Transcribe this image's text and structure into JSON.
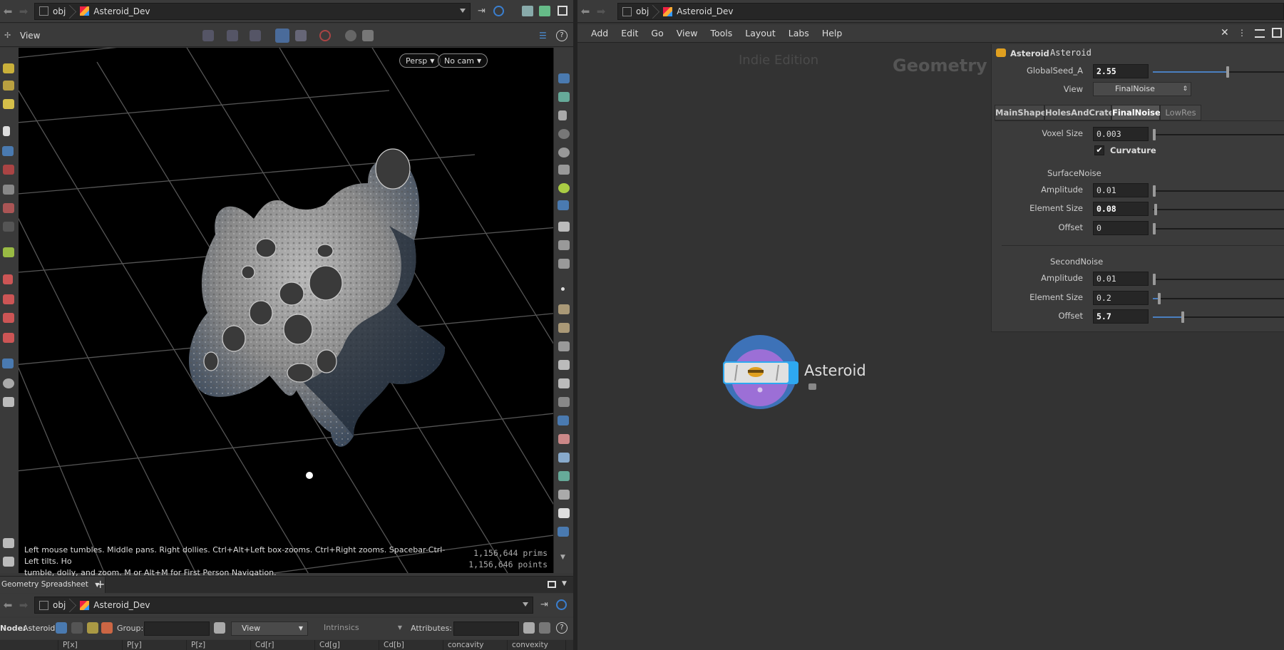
{
  "left_pane": {
    "path": {
      "root": "obj",
      "node": "Asteroid_Dev"
    },
    "viewbar": {
      "title": "View"
    },
    "viewport": {
      "camera_mode": "Persp",
      "camera": "No cam",
      "hint_line1": "Left mouse tumbles. Middle pans. Right dollies. Ctrl+Alt+Left box-zooms. Ctrl+Right zooms. Spacebar-Ctrl-Left tilts. Ho",
      "hint_line2": "tumble, dolly, and zoom.     M or Alt+M for First Person Navigation.",
      "prims": "1,156,644  prims",
      "points": "1,156,646 points"
    },
    "sheet": {
      "tab_label": "Geometry Spreadsheet",
      "add_tab": "+",
      "path": {
        "root": "obj",
        "node": "Asteroid_Dev"
      },
      "node_label": "Node:",
      "node_value": "Asteroid",
      "group_label": "Group:",
      "view_label": "View",
      "intrinsics_label": "Intrinsics",
      "attributes_label": "Attributes:",
      "columns": [
        "P[x]",
        "P[y]",
        "P[z]",
        "Cd[r]",
        "Cd[g]",
        "Cd[b]",
        "concavity",
        "convexity"
      ]
    }
  },
  "right_pane": {
    "path": {
      "root": "obj",
      "node": "Asteroid_Dev"
    },
    "menu": [
      "Add",
      "Edit",
      "Go",
      "View",
      "Tools",
      "Layout",
      "Labs",
      "Help"
    ],
    "watermark": "Indie Edition",
    "context_label": "Geometry",
    "node": {
      "name": "Asteroid"
    },
    "params": {
      "node_type": "Asteroid",
      "node_name": "Asteroid",
      "global_seed": {
        "label": "GlobalSeed_A",
        "value": "2.55",
        "level": 0.57
      },
      "view": {
        "label": "View",
        "value": "FinalNoise"
      },
      "tabs": [
        "MainShape",
        "HolesAndCraters",
        "FinalNoise",
        "LowRes"
      ],
      "active_tab": "FinalNoise",
      "voxel_size": {
        "label": "Voxel Size",
        "value": "0.003"
      },
      "curvature": {
        "label": "Curvature",
        "checked": true
      },
      "surface_noise": {
        "title": "SurfaceNoise",
        "amplitude": {
          "label": "Amplitude",
          "value": "0.01"
        },
        "element_size": {
          "label": "Element Size",
          "value": "0.08"
        },
        "offset": {
          "label": "Offset",
          "value": "0"
        }
      },
      "second_noise": {
        "title": "SecondNoise",
        "amplitude": {
          "label": "Amplitude",
          "value": "0.01"
        },
        "element_size": {
          "label": "Element Size",
          "value": "0.2"
        },
        "offset": {
          "label": "Offset",
          "value": "5.7"
        }
      }
    }
  }
}
